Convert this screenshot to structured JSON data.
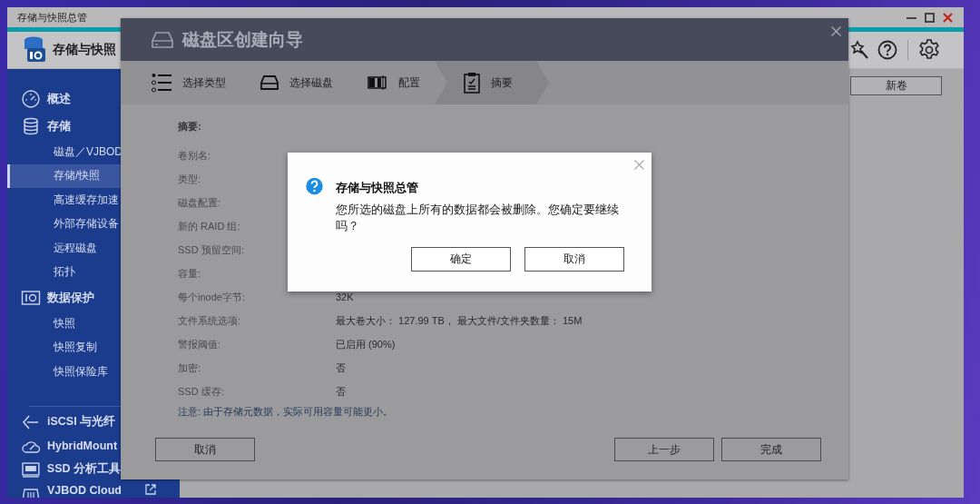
{
  "window": {
    "title": "存储与快照总管",
    "app_name": "存储与快照",
    "new_volume_button": "新卷"
  },
  "sidebar": {
    "groups": [
      [
        {
          "label": "概述",
          "selected": false
        },
        {
          "label": "存储",
          "selected": false,
          "children": [
            {
              "label": "磁盘／VJBOD",
              "selected": false
            },
            {
              "label": "存储/快照",
              "selected": true
            },
            {
              "label": "高速缓存加速",
              "selected": false
            },
            {
              "label": "外部存储设备",
              "selected": false
            },
            {
              "label": "远程磁盘",
              "selected": false
            },
            {
              "label": "拓扑",
              "selected": false
            }
          ]
        },
        {
          "label": "数据保护",
          "selected": false,
          "children": [
            {
              "label": "快照",
              "selected": false
            },
            {
              "label": "快照复制",
              "selected": false
            },
            {
              "label": "快照保险库",
              "selected": false
            }
          ]
        }
      ],
      [
        {
          "label": "iSCSI 与光纤",
          "selected": false
        },
        {
          "label": "HybridMount",
          "selected": false
        },
        {
          "label": "SSD 分析工具",
          "selected": false
        },
        {
          "label": "VJBOD Cloud",
          "selected": false,
          "external": true
        }
      ]
    ]
  },
  "wizard": {
    "title": "磁盘区创建向导",
    "steps": [
      {
        "label": "选择类型",
        "selected": false
      },
      {
        "label": "选择磁盘",
        "selected": false
      },
      {
        "label": "配置",
        "selected": false
      },
      {
        "label": "摘要",
        "selected": true
      }
    ],
    "summary_heading": "摘要:",
    "fields": [
      {
        "label": "卷别名:"
      },
      {
        "label": "类型:"
      },
      {
        "label": "磁盘配置:"
      },
      {
        "label": "新的 RAID 组:"
      },
      {
        "label": "SSD 预留空间:"
      },
      {
        "label": "容量:"
      },
      {
        "label": "每个inode字节:",
        "value": "32K"
      },
      {
        "label": "文件系统选项:",
        "value": "最大卷大小： 127.99 TB， 最大文件/文件夹数量： 15M"
      },
      {
        "label": "警报阈值:",
        "value": "已启用 (90%)"
      },
      {
        "label": "加密:",
        "value": "否"
      },
      {
        "label": "SSD 缓存:",
        "value": "否"
      }
    ],
    "note": "注意: 由于存储元数据，实际可用容量可能更小。",
    "buttons": {
      "cancel": "取消",
      "back": "上一步",
      "finish": "完成"
    }
  },
  "dialog": {
    "title": "存储与快照总管",
    "message": "您所选的磁盘上所有的数据都会被删除。您确定要继续吗？",
    "buttons": [
      "确定",
      "取消"
    ]
  }
}
